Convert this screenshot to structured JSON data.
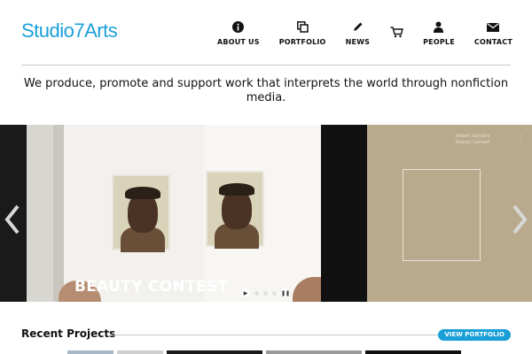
{
  "brand": {
    "name": "Studio7Arts",
    "color": "#1a9fd9"
  },
  "nav": {
    "items": [
      {
        "label": "ABOUT US",
        "icon": "info-icon"
      },
      {
        "label": "PORTFOLIO",
        "icon": "portfolio-icon"
      },
      {
        "label": "NEWS",
        "icon": "pencil-icon"
      },
      {
        "label": "",
        "icon": "cart-icon"
      },
      {
        "label": "PEOPLE",
        "icon": "person-icon"
      },
      {
        "label": "CONTACT",
        "icon": "envelope-icon"
      }
    ]
  },
  "tagline": "We produce, promote and support work that interprets the world through nonfiction media.",
  "slider": {
    "title": "BEAUTY CONTEST",
    "cover_text": [
      "Robert Sanders",
      "Beauty Contest"
    ],
    "dots": 4,
    "active_dot": 0
  },
  "recent": {
    "heading": "Recent Projects",
    "button_label": "VIEW PORTFOLIO"
  }
}
